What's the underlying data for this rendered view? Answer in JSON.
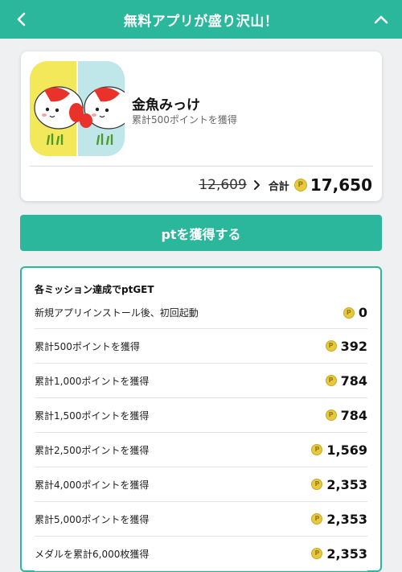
{
  "header": {
    "title": "無料アプリが盛り沢山！"
  },
  "app": {
    "name": "金魚みっけ",
    "subtitle": "累計500ポイントを獲得",
    "old_price": "12,609",
    "total_label": "合計",
    "total_value": "17,650"
  },
  "action": {
    "label": "ptを獲得する"
  },
  "missions": {
    "title": "各ミッション達成でptGET",
    "items": [
      {
        "label": "新規アプリインストール後、初回起動",
        "points": "0"
      },
      {
        "label": "累計500ポイントを獲得",
        "points": "392"
      },
      {
        "label": "累計1,000ポイントを獲得",
        "points": "784"
      },
      {
        "label": "累計1,500ポイントを獲得",
        "points": "784"
      },
      {
        "label": "累計2,500ポイントを獲得",
        "points": "1,569"
      },
      {
        "label": "累計4,000ポイントを獲得",
        "points": "2,353"
      },
      {
        "label": "累計5,000ポイントを獲得",
        "points": "2,353"
      },
      {
        "label": "メダルを累計6,000枚獲得",
        "points": "2,353"
      }
    ]
  },
  "coin_glyph": "P",
  "colors": {
    "accent": "#2bb79b",
    "coin": "#e6c93f",
    "background": "#eef0f2"
  },
  "icons": [
    "back-arrow-icon",
    "collapse-chevron-icon",
    "chevron-right-icon",
    "point-coin-icon"
  ]
}
